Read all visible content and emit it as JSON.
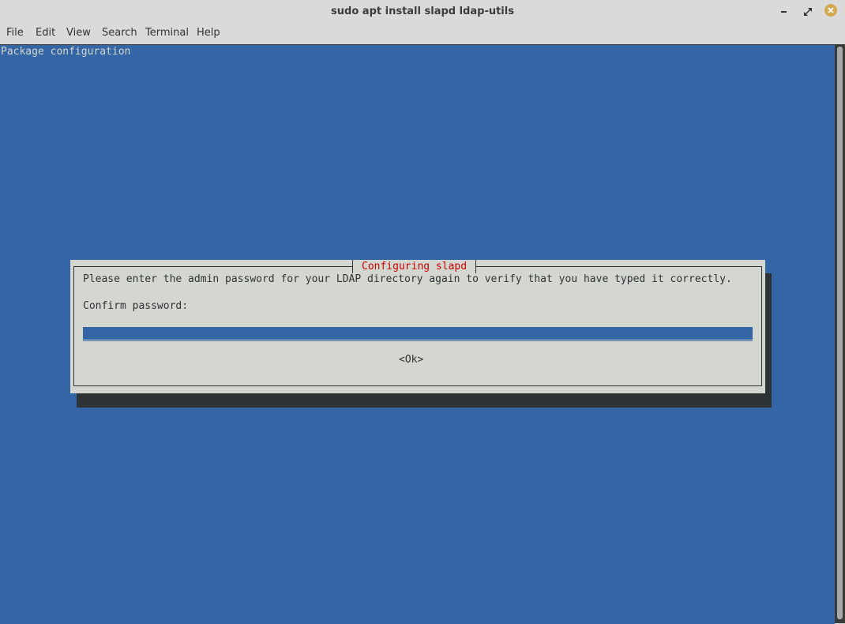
{
  "window": {
    "title": "sudo apt install slapd ldap-utils",
    "controls": [
      "minimize-icon",
      "maximize-icon",
      "close-icon"
    ],
    "close_color": "#d4a952"
  },
  "menu": {
    "items": [
      "File",
      "Edit",
      "View",
      "Search",
      "Terminal",
      "Help"
    ]
  },
  "terminal": {
    "header": "Package configuration",
    "background": "#3465a4"
  },
  "dialog": {
    "title": "Configuring slapd",
    "message": "Please enter the admin password for your LDAP directory again to verify that you have typed it correctly.",
    "field_label": "Confirm password:",
    "password_value": "",
    "ok_label": "<Ok>",
    "title_color": "#cc0000"
  }
}
